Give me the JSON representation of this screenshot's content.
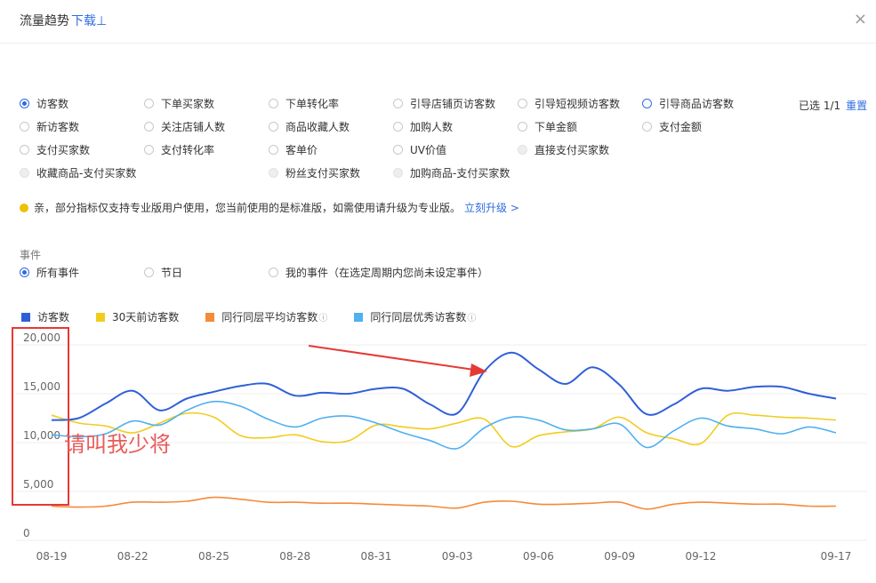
{
  "header": {
    "title": "流量趋势",
    "download": "下载⊥",
    "close": "×"
  },
  "metrics": [
    {
      "label": "访客数",
      "state": "checked",
      "col": 0,
      "row": 0
    },
    {
      "label": "下单买家数",
      "state": "normal",
      "col": 1,
      "row": 0
    },
    {
      "label": "下单转化率",
      "state": "normal",
      "col": 2,
      "row": 0
    },
    {
      "label": "引导店铺页访客数",
      "state": "normal",
      "col": 3,
      "row": 0
    },
    {
      "label": "引导短视频访客数",
      "state": "normal",
      "col": 4,
      "row": 0
    },
    {
      "label": "引导商品访客数",
      "state": "blue",
      "col": 5,
      "row": 0
    },
    {
      "label": "新访客数",
      "state": "normal",
      "col": 0,
      "row": 1
    },
    {
      "label": "关注店铺人数",
      "state": "normal",
      "col": 1,
      "row": 1
    },
    {
      "label": "商品收藏人数",
      "state": "normal",
      "col": 2,
      "row": 1
    },
    {
      "label": "加购人数",
      "state": "normal",
      "col": 3,
      "row": 1
    },
    {
      "label": "下单金额",
      "state": "normal",
      "col": 4,
      "row": 1
    },
    {
      "label": "支付金额",
      "state": "normal",
      "col": 5,
      "row": 1
    },
    {
      "label": "支付买家数",
      "state": "normal",
      "col": 0,
      "row": 2
    },
    {
      "label": "支付转化率",
      "state": "normal",
      "col": 1,
      "row": 2
    },
    {
      "label": "客单价",
      "state": "normal",
      "col": 2,
      "row": 2
    },
    {
      "label": "UV价值",
      "state": "normal",
      "col": 3,
      "row": 2
    },
    {
      "label": "直接支付买家数",
      "state": "disabled",
      "col": 4,
      "row": 2
    },
    {
      "label": "收藏商品-支付买家数",
      "state": "disabled",
      "col": 0,
      "row": 3
    },
    {
      "label": "粉丝支付买家数",
      "state": "disabled",
      "col": 2,
      "row": 3
    },
    {
      "label": "加购商品-支付买家数",
      "state": "disabled",
      "col": 3,
      "row": 3
    }
  ],
  "selection": {
    "count": "已选 1/1",
    "reset": "重置"
  },
  "notice": {
    "text": "亲，部分指标仅支持专业版用户使用，您当前使用的是标准版，如需使用请升级为专业版。",
    "link": "立刻升级 >"
  },
  "events": {
    "label": "事件",
    "options": [
      {
        "label": "所有事件",
        "state": "checked"
      },
      {
        "label": "节日",
        "state": "normal"
      },
      {
        "label": "我的事件（在选定周期内您尚未设定事件）",
        "state": "normal"
      }
    ]
  },
  "annotation": {
    "text": "请叫我少将",
    "box_color": "#e53935"
  },
  "colors": {
    "accent": "#2f6ce0"
  },
  "chart_data": {
    "type": "line",
    "title": "",
    "xlabel": "",
    "ylabel": "",
    "ylim": [
      0,
      20000
    ],
    "yticks": [
      "20,000",
      "15,000",
      "10,000",
      "5,000",
      "0"
    ],
    "ytick_values": [
      20000,
      15000,
      10000,
      5000,
      0
    ],
    "xtick_labels": [
      "08-19",
      "08-22",
      "08-25",
      "08-28",
      "08-31",
      "09-03",
      "09-06",
      "09-09",
      "09-12",
      "09-17"
    ],
    "xtick_index": [
      0,
      3,
      6,
      9,
      12,
      15,
      18,
      21,
      24,
      29
    ],
    "x": [
      "08-19",
      "08-20",
      "08-21",
      "08-22",
      "08-23",
      "08-24",
      "08-25",
      "08-26",
      "08-27",
      "08-28",
      "08-29",
      "08-30",
      "08-31",
      "09-01",
      "09-02",
      "09-03",
      "09-04",
      "09-05",
      "09-06",
      "09-07",
      "09-08",
      "09-09",
      "09-10",
      "09-11",
      "09-12",
      "09-13",
      "09-14",
      "09-15",
      "09-16",
      "09-17"
    ],
    "legend_position": "top-left",
    "grid": true,
    "series": [
      {
        "name": "访客数",
        "color": "#2f5fd8",
        "values": [
          12300,
          12500,
          14000,
          15300,
          13300,
          14500,
          15200,
          15800,
          16000,
          14800,
          15100,
          15000,
          15500,
          15500,
          13900,
          13000,
          17300,
          19200,
          17500,
          16000,
          17700,
          15900,
          12900,
          13900,
          15500,
          15300,
          15700,
          15700,
          15000,
          14500
        ]
      },
      {
        "name": "30天前访客数",
        "color": "#f2cc1d",
        "values": [
          12800,
          12000,
          11700,
          11000,
          12000,
          13000,
          12600,
          10700,
          10500,
          10800,
          10100,
          10200,
          11800,
          11600,
          11400,
          12000,
          12400,
          9600,
          10700,
          11100,
          11400,
          12600,
          11000,
          10400,
          9900,
          12800,
          12800,
          12600,
          12500,
          12300
        ]
      },
      {
        "name": "同行同层平均访客数",
        "color": "#f58a3a",
        "values": [
          3500,
          3400,
          3500,
          3900,
          3900,
          4000,
          4400,
          4200,
          3900,
          3900,
          3800,
          3800,
          3700,
          3600,
          3500,
          3300,
          3900,
          4000,
          3700,
          3700,
          3800,
          3900,
          3200,
          3700,
          3900,
          3800,
          3700,
          3700,
          3500,
          3500
        ]
      },
      {
        "name": "同行同层优秀访客数",
        "color": "#4fb0f2",
        "values": [
          10800,
          10600,
          10900,
          12200,
          11800,
          13300,
          14200,
          13700,
          12400,
          11600,
          12500,
          12700,
          12000,
          11000,
          10200,
          9400,
          11500,
          12600,
          12300,
          11300,
          11400,
          11900,
          9500,
          11200,
          12500,
          11700,
          11400,
          10900,
          11600,
          11000
        ]
      }
    ]
  }
}
